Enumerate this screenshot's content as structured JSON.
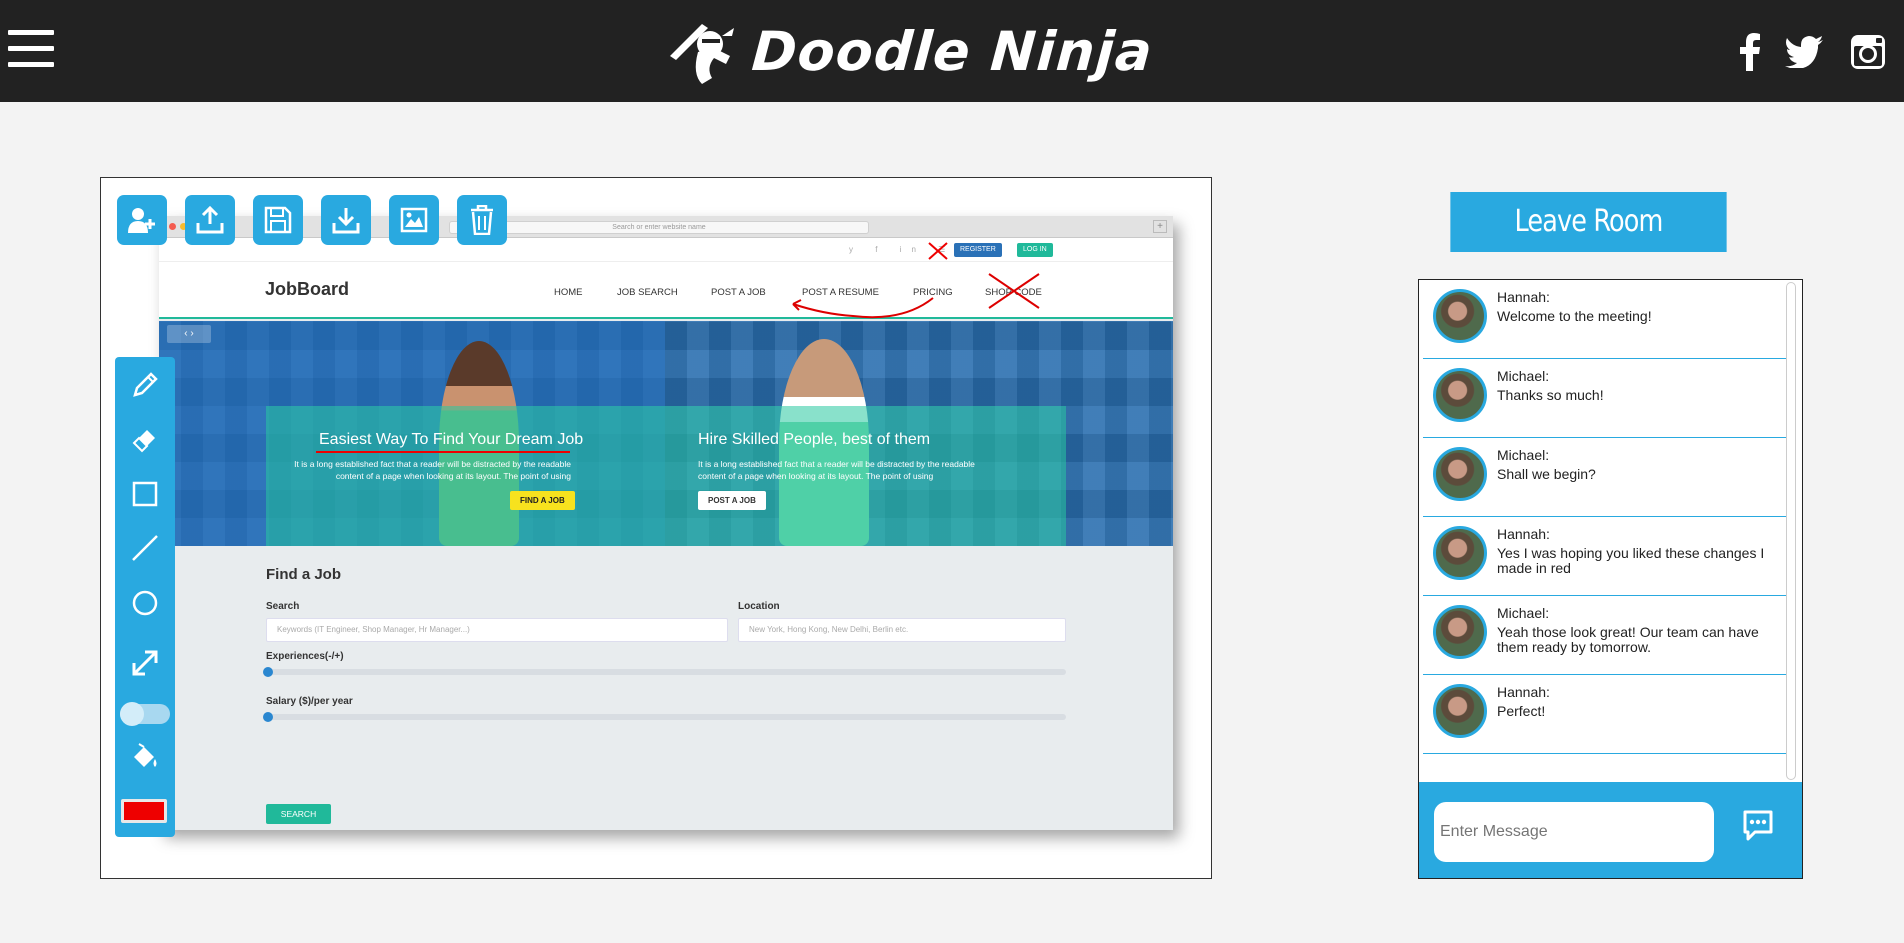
{
  "header": {
    "brand": "Doodle Ninja",
    "social": [
      "facebook-icon",
      "twitter-icon",
      "instagram-icon"
    ]
  },
  "toolbar": {
    "top_tools": [
      "add-user-icon",
      "upload-icon",
      "save-icon",
      "download-icon",
      "image-icon",
      "trash-icon"
    ],
    "side_tools": [
      "pencil-icon",
      "eraser-icon",
      "square-icon",
      "line-icon",
      "circle-icon",
      "resize-icon",
      "size-toggle",
      "paint-bucket-icon",
      "color-swatch"
    ],
    "selected_color": "#ee0000",
    "accent": "#29a9e0"
  },
  "screenshot": {
    "url_placeholder": "Search or enter website name",
    "register": "REGISTER",
    "login": "LOG IN",
    "brand": "JobBoard",
    "nav": [
      "HOME",
      "JOB SEARCH",
      "POST A JOB",
      "POST A RESUME",
      "PRICING",
      "SHOP CODE"
    ],
    "hero_left_title": "Easiest Way To Find Your Dream Job",
    "hero_left_text": "It is a long established fact that a reader will be distracted by the readable content of a page when looking at its layout. The point of using",
    "hero_left_btn": "FIND A JOB",
    "hero_right_title": "Hire Skilled People, best of them",
    "hero_right_text": "It is a long established fact that a reader will be distracted by the readable content of a page when looking at its layout. The point of using",
    "hero_right_btn": "POST A JOB",
    "find_title": "Find a Job",
    "search_label": "Search",
    "search_placeholder": "Keywords (IT Engineer, Shop Manager, Hr Manager...)",
    "location_label": "Location",
    "location_placeholder": "New York, Hong Kong, New Delhi, Berlin etc.",
    "experience_label": "Experiences(-/+)",
    "salary_label": "Salary ($)/per year",
    "search_btn": "SEARCH"
  },
  "room": {
    "leave_label": "Leave Room"
  },
  "chat": {
    "messages": [
      {
        "name": "Hannah:",
        "text": "Welcome to the meeting!"
      },
      {
        "name": "Michael:",
        "text": "Thanks so much!"
      },
      {
        "name": "Michael:",
        "text": "Shall we begin?"
      },
      {
        "name": "Hannah:",
        "text": "Yes I was hoping you liked these changes I made in red"
      },
      {
        "name": "Michael:",
        "text": "Yeah those look great! Our team can have them ready by tomorrow."
      },
      {
        "name": "Hannah:",
        "text": "Perfect!"
      }
    ],
    "input_placeholder": "Enter Message"
  }
}
